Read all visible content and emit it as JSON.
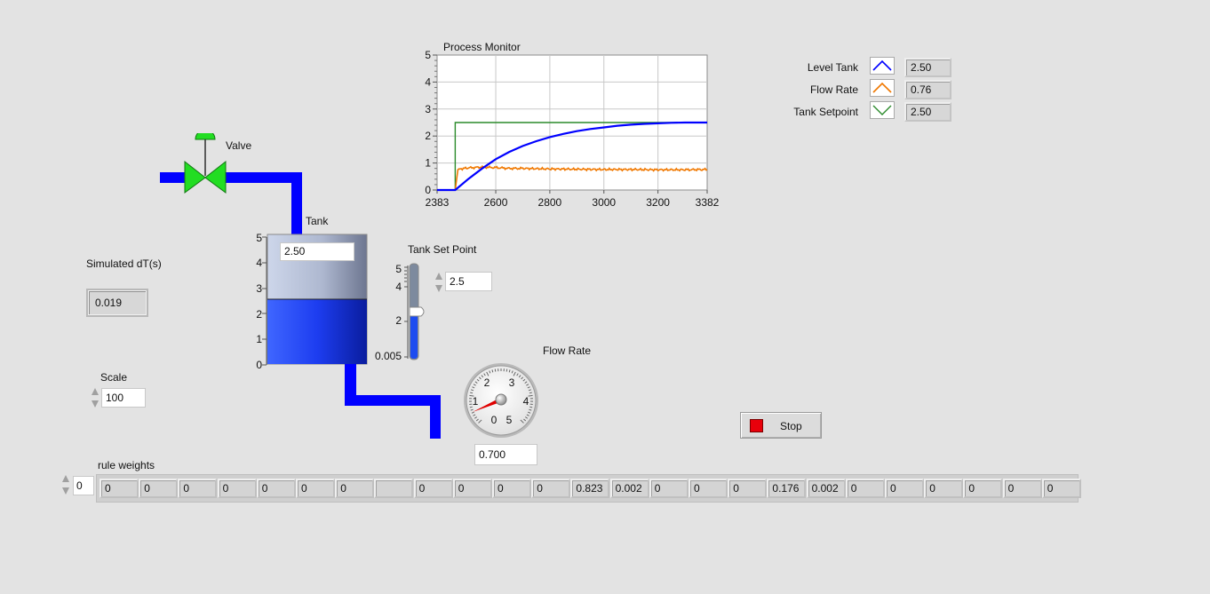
{
  "process_monitor": {
    "title": "Process Monitor",
    "y_ticks": [
      "5",
      "4",
      "3",
      "2",
      "1",
      "0"
    ],
    "x_ticks": [
      "2383",
      "2600",
      "2800",
      "3000",
      "3200",
      "3382"
    ]
  },
  "chart_data": {
    "type": "line",
    "title": "Process Monitor",
    "xlabel": "",
    "ylabel": "",
    "xlim": [
      2383,
      3382
    ],
    "ylim": [
      0,
      5
    ],
    "grid": true,
    "series": [
      {
        "name": "Level Tank",
        "color": "#0000ff",
        "x": [
          2383,
          2450,
          2450,
          2500,
          2550,
          2600,
          2650,
          2700,
          2750,
          2800,
          2850,
          2900,
          2950,
          3000,
          3050,
          3100,
          3150,
          3200,
          3250,
          3300,
          3382
        ],
        "y": [
          0,
          0,
          0,
          0.42,
          0.8,
          1.14,
          1.41,
          1.63,
          1.81,
          1.96,
          2.08,
          2.18,
          2.26,
          2.32,
          2.38,
          2.42,
          2.45,
          2.47,
          2.49,
          2.5,
          2.5
        ]
      },
      {
        "name": "Flow Rate",
        "color": "#f07800",
        "x": [
          2383,
          2450,
          2460,
          2480,
          2500,
          2550,
          2600,
          2650,
          2700,
          2800,
          2900,
          3000,
          3100,
          3200,
          3300,
          3382
        ],
        "y": [
          0,
          0,
          0.75,
          0.8,
          0.82,
          0.85,
          0.83,
          0.8,
          0.8,
          0.78,
          0.77,
          0.76,
          0.76,
          0.75,
          0.75,
          0.76
        ]
      },
      {
        "name": "Tank Setpoint",
        "color": "#2a8a2a",
        "x": [
          2383,
          2450,
          2450,
          3382
        ],
        "y": [
          0,
          0,
          2.5,
          2.5
        ]
      }
    ]
  },
  "legend": {
    "items": [
      {
        "label": "Level Tank",
        "value": "2.50",
        "color": "#0000ff"
      },
      {
        "label": "Flow Rate",
        "value": "0.76",
        "color": "#f07800"
      },
      {
        "label": "Tank Setpoint",
        "value": "2.50",
        "color": "#2a8a2a"
      }
    ]
  },
  "valve": {
    "label": "Valve",
    "color": "#22dd22"
  },
  "tank": {
    "label": "Tank",
    "value": "2.50",
    "level": 2.5,
    "scale": [
      "5",
      "4",
      "3",
      "2",
      "1",
      "0"
    ],
    "fill_color": "#1d3df0"
  },
  "simulated_dt": {
    "label": "Simulated dT(s)",
    "value": "0.019"
  },
  "scale_ctrl": {
    "label": "Scale",
    "value": "100"
  },
  "setpoint": {
    "label": "Tank Set Point",
    "value": "2.5",
    "level": 2.5,
    "scale": [
      "5",
      "4",
      "2",
      "0.005"
    ]
  },
  "flow_rate": {
    "label": "Flow Rate",
    "value": "0.700",
    "dial_ticks": [
      "0",
      "1",
      "2",
      "3",
      "4",
      "5"
    ]
  },
  "stop": {
    "label": "Stop"
  },
  "rule_weights": {
    "label": "rule weights",
    "index": "0",
    "values": [
      "0",
      "0",
      "0",
      "0",
      "0",
      "0",
      "0",
      "",
      "0",
      "0",
      "0",
      "0",
      "0.823",
      "0.002",
      "0",
      "0",
      "0",
      "0.176",
      "0.002",
      "0",
      "0",
      "0",
      "0",
      "0",
      "0"
    ]
  },
  "colors": {
    "pipe": "#0000ff",
    "valve": "#22dd22",
    "background": "#e3e3e3"
  }
}
